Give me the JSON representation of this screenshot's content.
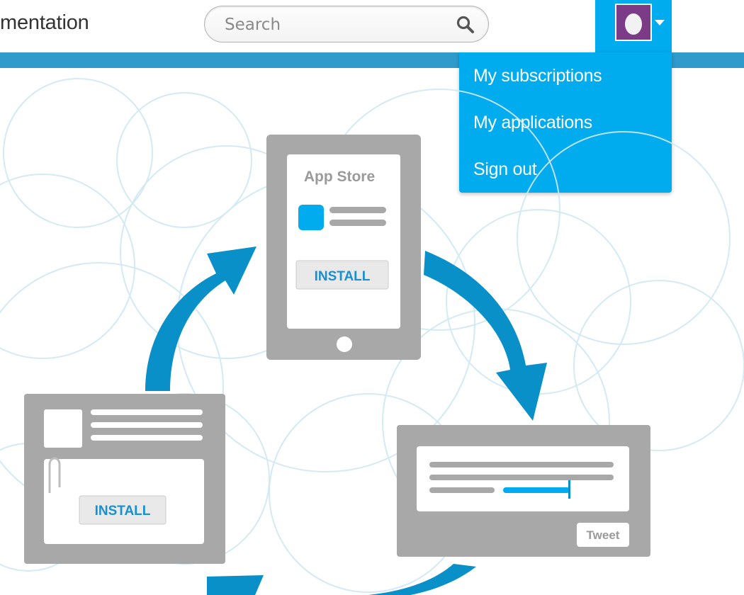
{
  "header": {
    "title_partial": "mentation",
    "search": {
      "placeholder": "Search",
      "value": ""
    }
  },
  "user_menu": {
    "avatar_color": "#7b3b86",
    "items": [
      {
        "label": "My subscriptions"
      },
      {
        "label": "My applications"
      },
      {
        "label": "Sign out"
      }
    ]
  },
  "illustration": {
    "tablet_title": "App Store",
    "tablet_button": "INSTALL",
    "email_button": "INSTALL",
    "tweet_button": "Tweet"
  },
  "colors": {
    "accent": "#00aced",
    "strip": "#2e9bcc",
    "arrow": "#0a90c8",
    "device_gray": "#a8a8a8"
  }
}
